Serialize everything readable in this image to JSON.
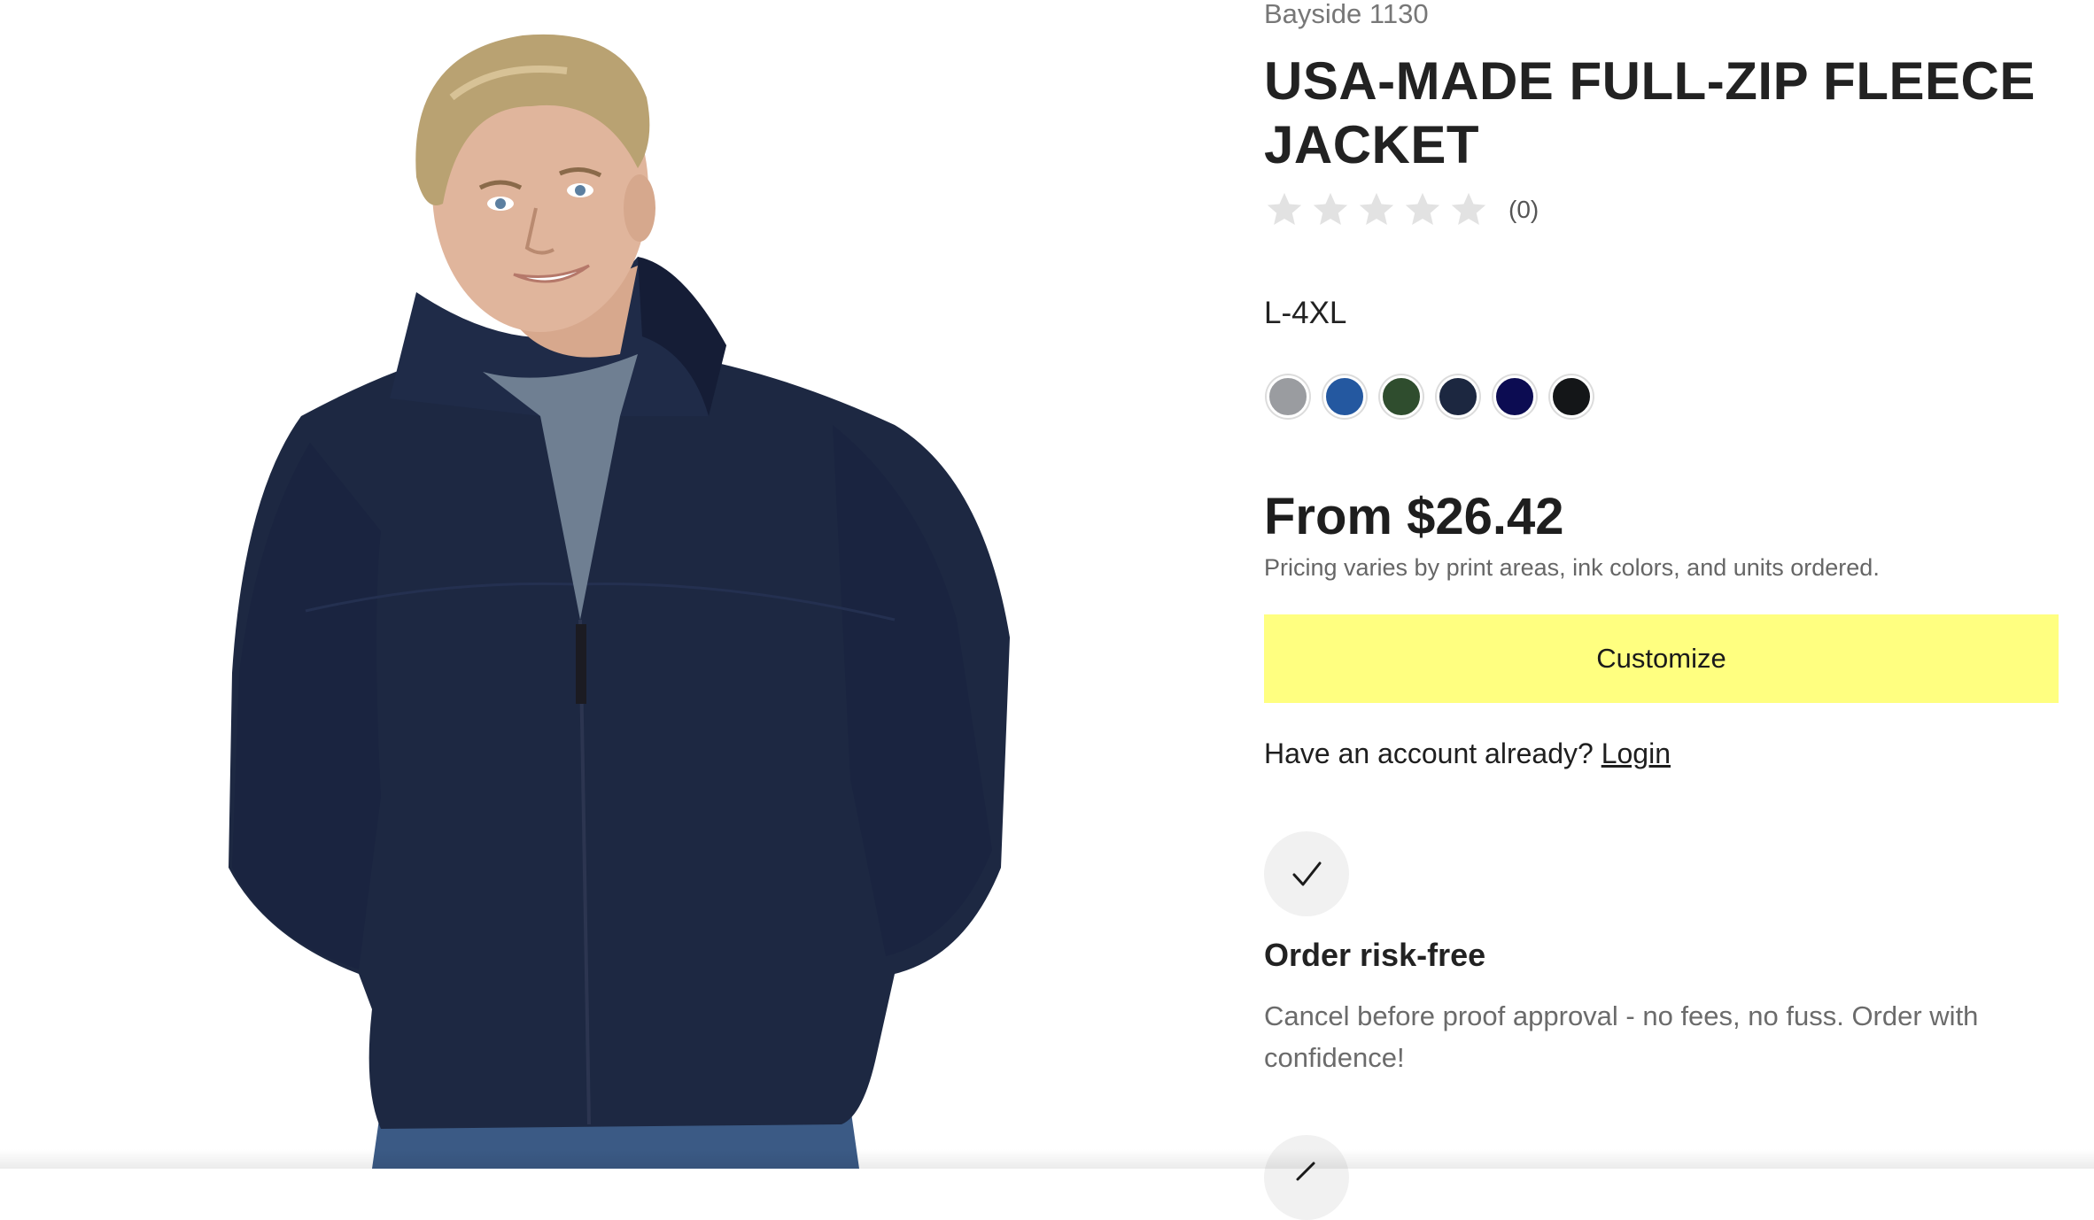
{
  "product": {
    "brand": "Bayside 1130",
    "title": "USA-MADE FULL-ZIP FLEECE JACKET",
    "rating_stars": 0,
    "rating_count": "(0)",
    "size_range": "L-4XL",
    "swatches": [
      {
        "name": "Grey",
        "color": "#9a9ca0"
      },
      {
        "name": "Royal Blue",
        "color": "#2458a0"
      },
      {
        "name": "Forest Green",
        "color": "#2f4d2e"
      },
      {
        "name": "Dark Navy",
        "color": "#1c2740"
      },
      {
        "name": "Navy",
        "color": "#0c0c52"
      },
      {
        "name": "Black",
        "color": "#141618"
      }
    ],
    "price": "From $26.42",
    "price_note": "Pricing varies by print areas, ink colors, and units ordered."
  },
  "actions": {
    "customize_label": "Customize",
    "account_prompt": "Have an account already?",
    "login_label": "Login"
  },
  "features": [
    {
      "icon": "checkmark-icon",
      "title": "Order risk-free",
      "text": "Cancel before proof approval - no fees, no fuss. Order with confidence!"
    }
  ],
  "colors": {
    "customize_button": "#ffff80",
    "jacket": "#1c2740"
  }
}
